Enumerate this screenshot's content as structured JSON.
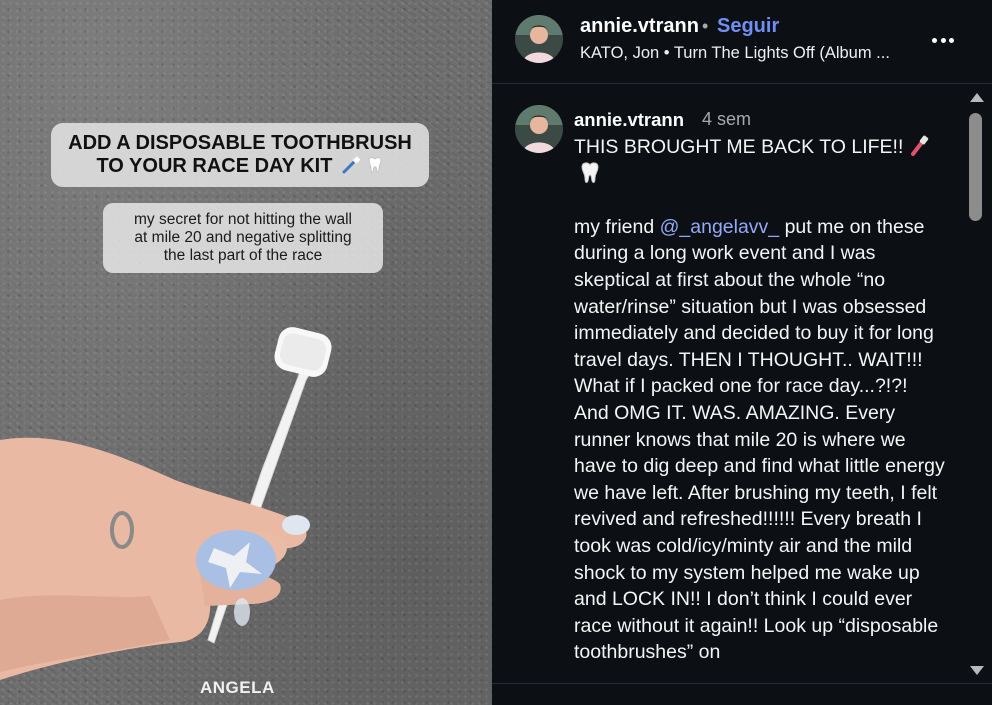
{
  "media": {
    "caption_line_1": "ADD A DISPOSABLE TOOTHBRUSH",
    "caption_line_2": "TO YOUR RACE DAY KIT",
    "subcaption_line_1": "my secret for not hitting the wall",
    "subcaption_line_2": "at mile 20 and negative splitting",
    "subcaption_line_3": "the last part of the race",
    "watermark": "ANGELA"
  },
  "header": {
    "username": "annie.vtrann",
    "separator": "•",
    "follow_label": "Seguir",
    "audio_text": "KATO, Jon • Turn The Lights Off (Album ..."
  },
  "comment": {
    "username": "annie.vtrann",
    "time": "4 sem",
    "line1": "THIS BROUGHT ME BACK TO LIFE!!",
    "mention_prefix": "my friend ",
    "mention": "@_angelavv_",
    "body": " put me on these during a long work event and I was skeptical at first about the whole “no water/rinse” situation but I was obsessed immediately and decided to buy it for long travel days. THEN I THOUGHT.. WAIT!!! What if I packed one for race day...?!?! And OMG IT. WAS. AMAZING. Every runner knows that mile 20 is where we have to dig deep and find what little energy we have left. After brushing my teeth, I felt revived and refreshed!!!!!! Every breath I took was cold/icy/minty air and the mild shock to my system helped me wake up and LOCK IN!! I don’t think I could ever race without it again!! Look up “disposable toothbrushes” on"
  },
  "icons": {
    "more": "more-horizontal-icon",
    "toothbrush": "toothbrush-emoji-icon",
    "tooth": "tooth-emoji-icon"
  },
  "colors": {
    "panel_bg": "#0c0f14",
    "follow": "#6f8ff5",
    "mention": "#92a9f5"
  }
}
